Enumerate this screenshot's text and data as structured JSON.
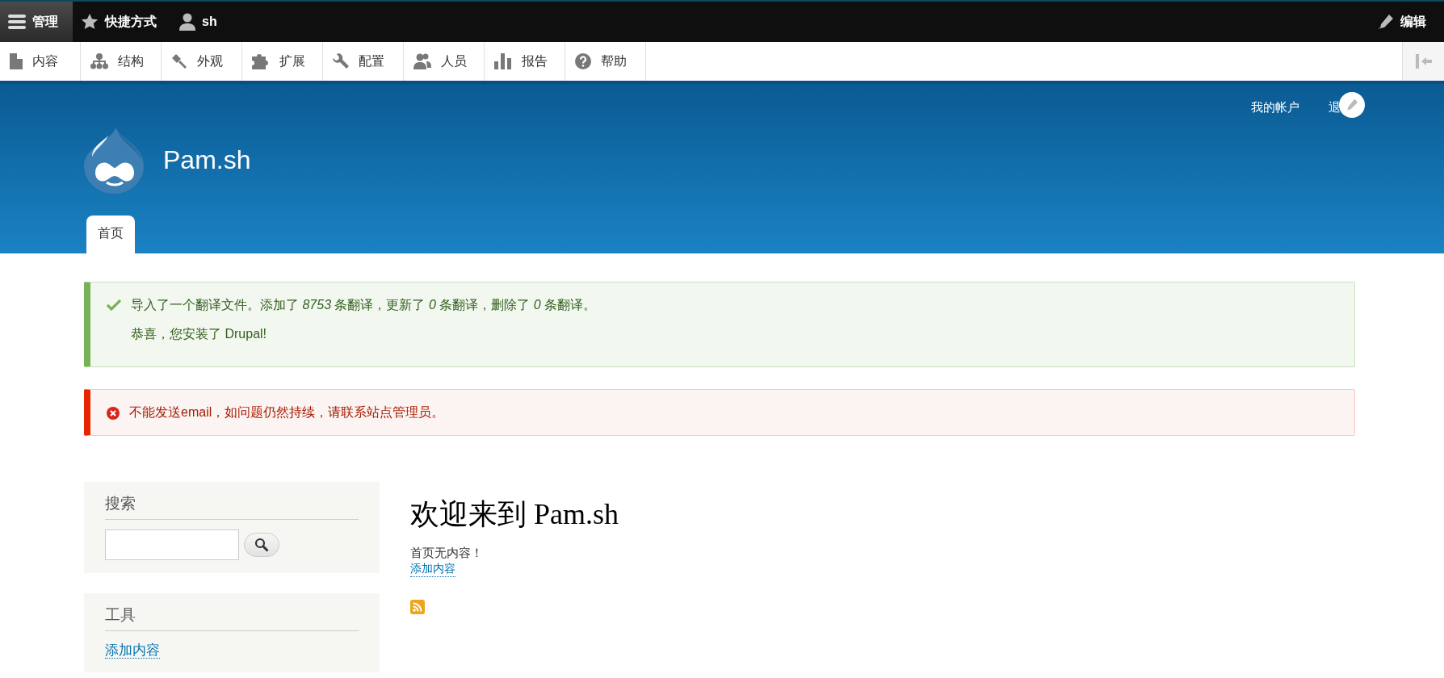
{
  "toolbar": {
    "items": [
      {
        "label": "管理",
        "selected": true
      },
      {
        "label": "快捷方式",
        "selected": false
      },
      {
        "label": "sh",
        "selected": false
      }
    ],
    "edit": "编辑"
  },
  "tray": {
    "items": [
      {
        "label": "内容"
      },
      {
        "label": "结构"
      },
      {
        "label": "外观"
      },
      {
        "label": "扩展"
      },
      {
        "label": "配置"
      },
      {
        "label": "人员"
      },
      {
        "label": "报告"
      },
      {
        "label": "帮助"
      }
    ]
  },
  "header": {
    "secondary_menu": [
      "我的帐户",
      "退"
    ],
    "site_name": "Pam.sh",
    "tabs": [
      {
        "label": "首页",
        "selected": true
      }
    ]
  },
  "messages": [
    {
      "kind": "status",
      "lines": [
        "导入了一个翻译文件。添加了 *8753* 条翻译，更新了 *0* 条翻译，删除了 *0* 条翻译。",
        "恭喜，您安装了 Drupal!"
      ]
    },
    {
      "kind": "error",
      "lines": [
        "不能发送email，如问题仍然持续，请联系站点管理员。"
      ]
    }
  ],
  "sidebar": {
    "blocks": [
      {
        "kind": "search",
        "title": "搜索"
      },
      {
        "kind": "links",
        "title": "工具",
        "links": [
          "添加内容"
        ]
      }
    ]
  },
  "main": {
    "title": "欢迎来到 Pam.sh",
    "text": "首页无内容！",
    "link": "添加内容"
  }
}
